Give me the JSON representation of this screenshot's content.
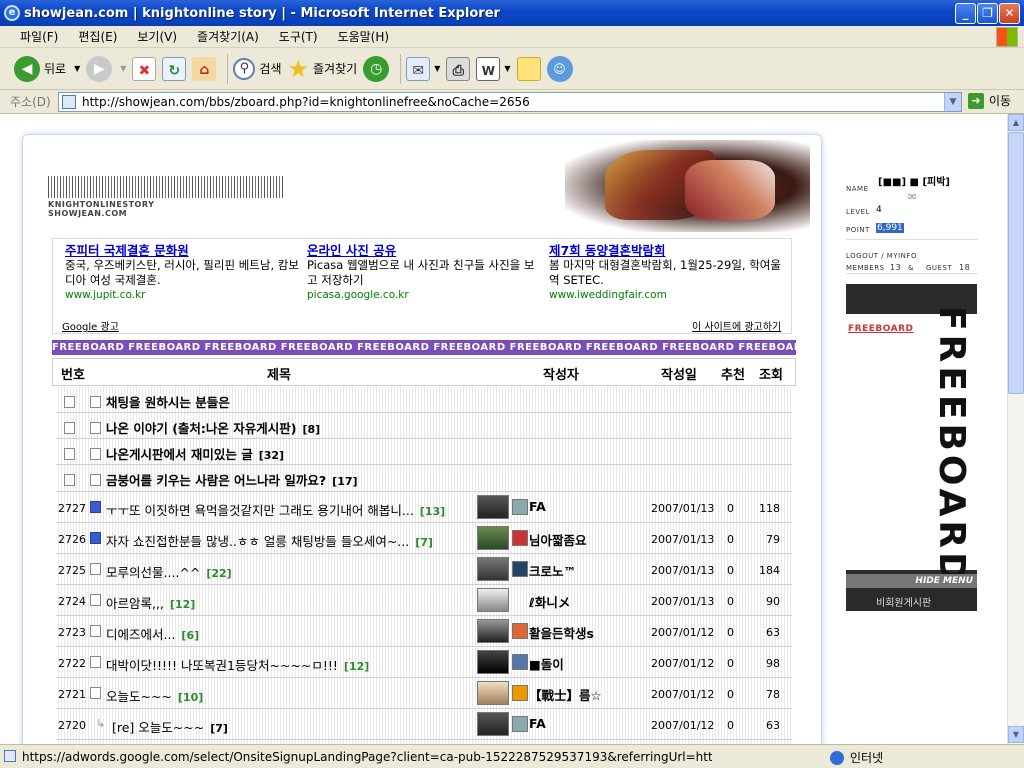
{
  "window": {
    "title": "showjean.com | knightonline story | - Microsoft Internet Explorer"
  },
  "menu": [
    "파일(F)",
    "편집(E)",
    "보기(V)",
    "즐겨찾기(A)",
    "도구(T)",
    "도움말(H)"
  ],
  "toolbar": {
    "back": "뒤로",
    "search": "검색",
    "favorites": "즐겨찾기"
  },
  "address": {
    "label": "주소(D)",
    "url": "http://showjean.com/bbs/zboard.php?id=knightonlinefree&noCache=2656",
    "go": "이동"
  },
  "status": {
    "text": "https://adwords.google.com/select/OnsiteSignupLandingPage?client=ca-pub-1522287529537193&referringUrl=http://show",
    "zone": "인터넷"
  },
  "site": {
    "name_line1": "KNIGHTONLINESTORY",
    "name_line2": "SHOWJEAN.COM"
  },
  "ads": [
    {
      "title": "주피터 국제결혼 문화원",
      "desc": "중국, 우즈베키스탄, 러시아, 필리핀 베트남, 캄보디아 여성 국제결혼.",
      "url": "www.jupit.co.kr"
    },
    {
      "title": "온라인 사진 공유",
      "desc": "Picasa 웹앨범으로 내 사진과 친구들 사진을 보고 저장하기",
      "url": "picasa.google.co.kr"
    },
    {
      "title": "제7회 동양결혼박람회",
      "desc": "봄 마지막 대형결혼박람회, 1월25-29일, 학여울역 SETEC.",
      "url": "www.iweddingfair.com"
    }
  ],
  "ads_footer": {
    "left": "Google 광고",
    "right": "이 사이트에 광고하기"
  },
  "strip": "FREEBOARD FREEBOARD FREEBOARD FREEBOARD FREEBOARD FREEBOARD FREEBOARD FREEBOARD FREEBOARD FREEBOARD FREEBOARD",
  "table_head": {
    "no": "번호",
    "title": "제목",
    "author": "작성자",
    "date": "작성일",
    "rec": "추천",
    "views": "조회"
  },
  "notices": [
    {
      "title": "채팅을 원하시는 분들은",
      "count": ""
    },
    {
      "title": "나온 이야기 (출처:나온 자유게시판)",
      "count": "[8]"
    },
    {
      "title": "나온게시판에서 재미있는 글",
      "count": "[32]"
    },
    {
      "title": "금붕어를 키우는 사람은 어느나라 일까요?",
      "count": "[17]"
    }
  ],
  "posts": [
    {
      "no": "2727",
      "title": "ㅜㅜ또 이짓하면 욕먹을것같지만 그래도 용기내어 해봅니...",
      "count": "[13]",
      "author": "FA",
      "date": "2007/01/13",
      "rec": "0",
      "views": "118"
    },
    {
      "no": "2726",
      "title": "자자 쇼진접한분들 많냉..ㅎㅎ 얼릉 채팅방들 들오세여~...",
      "count": "[7]",
      "author": "님아짧좀요",
      "date": "2007/01/13",
      "rec": "0",
      "views": "79"
    },
    {
      "no": "2725",
      "title": "모루의선물....^^",
      "count": "[22]",
      "author": "크로노™",
      "date": "2007/01/13",
      "rec": "0",
      "views": "184"
    },
    {
      "no": "2724",
      "title": "아르암록,,,",
      "count": "[12]",
      "author": "ℓ화니メ",
      "date": "2007/01/13",
      "rec": "0",
      "views": "90"
    },
    {
      "no": "2723",
      "title": "디에즈에서...",
      "count": "[6]",
      "author": "활을든학생s",
      "date": "2007/01/12",
      "rec": "0",
      "views": "63"
    },
    {
      "no": "2722",
      "title": "대박이닷!!!!! 나또복권1등당처~~~~ㅁ!!!",
      "count": "[12]",
      "author": "■돌이",
      "date": "2007/01/12",
      "rec": "0",
      "views": "98"
    },
    {
      "no": "2721",
      "title": "오늘도~~~",
      "count": "[10]",
      "author": "【戰士】름☆",
      "date": "2007/01/12",
      "rec": "0",
      "views": "78"
    },
    {
      "no": "2720",
      "title": "[re] 오늘도~~~",
      "count": "[7]",
      "author": "FA",
      "date": "2007/01/12",
      "rec": "0",
      "views": "63"
    }
  ],
  "side": {
    "name_label": "NAME",
    "name_value": "[■■] ■ [피박]",
    "level_label": "LEVEL",
    "level_value": "4",
    "point_label": "POINT",
    "point_value": "6,991",
    "logout": "LOGOUT / MYINFO",
    "members_label": "MEMBERS",
    "members": "13",
    "guest_label": "GUEST",
    "guest": "18"
  },
  "panel": {
    "big": "FREEBOARD",
    "link": "FREEBOARD",
    "hide": "HIDE MENU",
    "nonmember": "비회원게시판"
  }
}
